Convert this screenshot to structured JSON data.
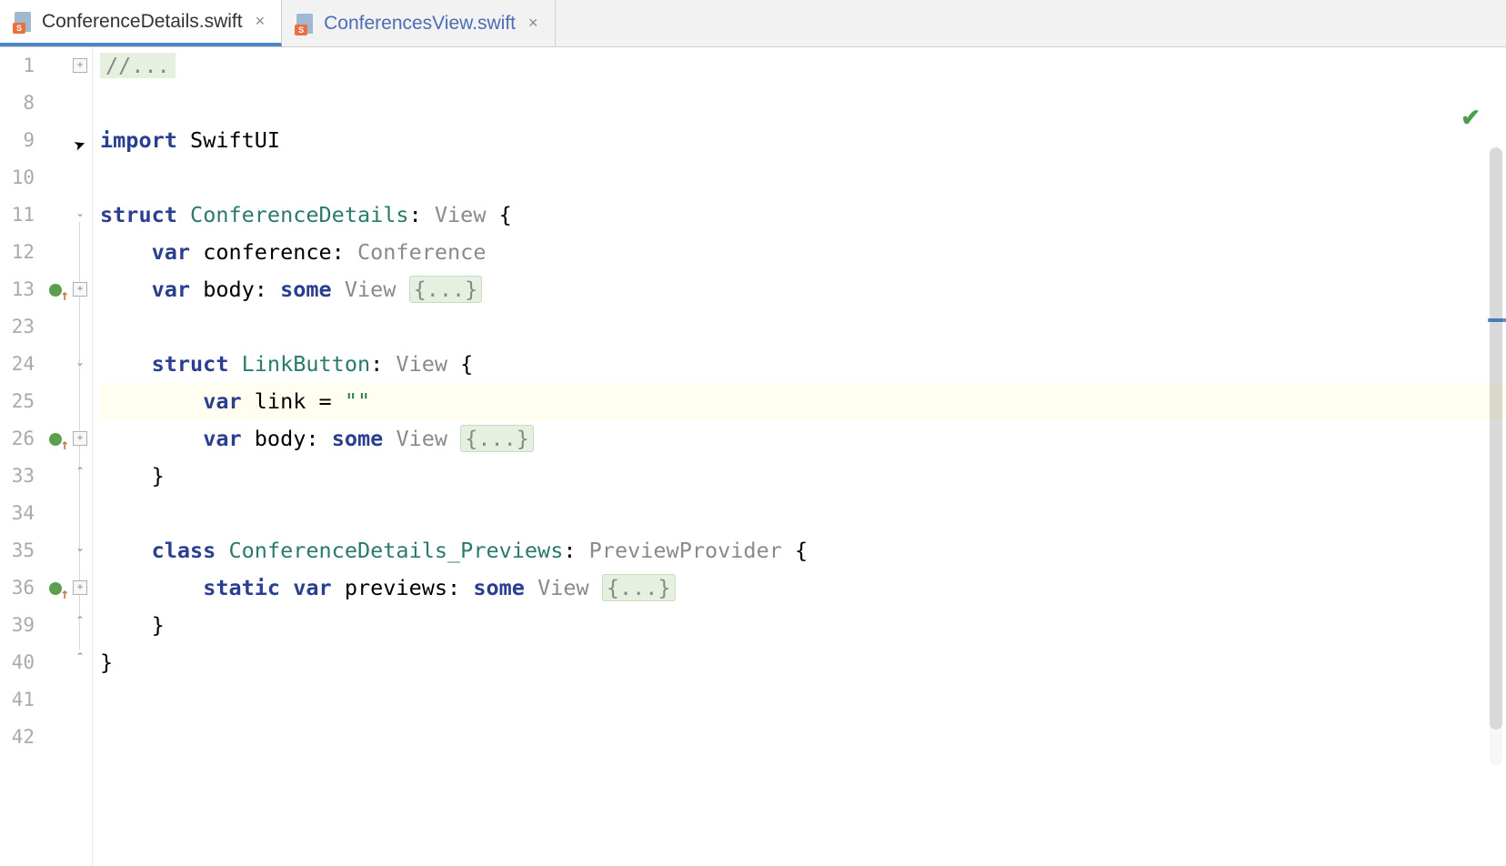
{
  "tabs": [
    {
      "label": "ConferenceDetails.swift",
      "active": true
    },
    {
      "label": "ConferencesView.swift",
      "active": false
    }
  ],
  "gutter_lines": [
    "1",
    "8",
    "9",
    "10",
    "11",
    "12",
    "13",
    "23",
    "24",
    "25",
    "26",
    "33",
    "34",
    "35",
    "36",
    "39",
    "40",
    "41",
    "42"
  ],
  "run_markers_at": [
    "13",
    "26",
    "36"
  ],
  "code": {
    "l1_comment": "//...",
    "l9_import": "import",
    "l9_module": "SwiftUI",
    "l11_struct": "struct",
    "l11_name": "ConferenceDetails",
    "l11_colon": ": ",
    "l11_proto": "View",
    "l11_brace": " {",
    "l12_var": "var",
    "l12_name": " conference: ",
    "l12_type": "Conference",
    "l13_var": "var",
    "l13_name": " body: ",
    "l13_some": "some",
    "l13_view": "View",
    "l13_fold": "{...}",
    "l24_struct": "struct",
    "l24_name": "LinkButton",
    "l24_colon": ": ",
    "l24_proto": "View",
    "l24_brace": " {",
    "l25_var": "var",
    "l25_rest": " link = ",
    "l25_str": "\"\"",
    "l26_var": "var",
    "l26_name": " body: ",
    "l26_some": "some",
    "l26_view": "View",
    "l26_fold": "{...}",
    "l33_brace": "}",
    "l35_class": "class",
    "l35_name": "ConferenceDetails_Previews",
    "l35_colon": ": ",
    "l35_proto": "PreviewProvider",
    "l35_brace": " {",
    "l36_static": "static",
    "l36_var": "var",
    "l36_name": " previews: ",
    "l36_some": "some",
    "l36_view": "View",
    "l36_fold": "{...}",
    "l39_brace": "}",
    "l40_brace": "}"
  },
  "status": {
    "inspection": "ok"
  }
}
